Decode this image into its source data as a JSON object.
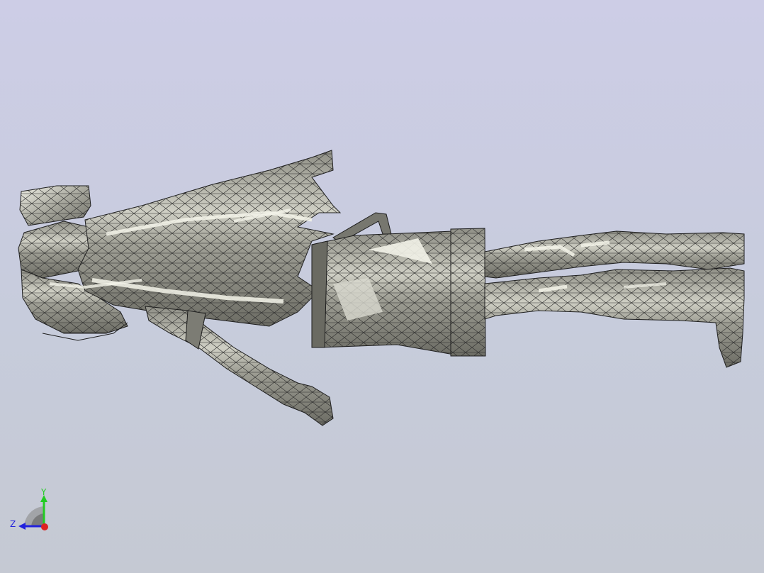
{
  "viewport": {
    "background_top": "#cdcde6",
    "background_bottom": "#c5c9d3"
  },
  "model": {
    "name": "figure-mesh",
    "fill": "#a4a49a",
    "edge": "#1d1d1d",
    "highlight": "#f2f2e8"
  },
  "triad": {
    "y_label": "Y",
    "z_label": "Z",
    "y_color": "#22cc22",
    "z_color": "#2222dd",
    "x_color": "#dd2222"
  }
}
